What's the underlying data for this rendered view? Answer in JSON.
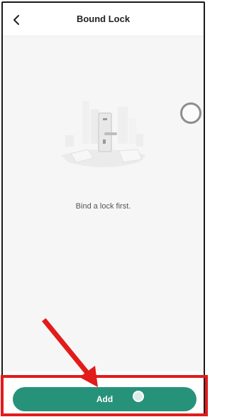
{
  "header": {
    "title": "Bound Lock",
    "back_icon": "chevron-left-icon"
  },
  "empty_state": {
    "message": "Bind a lock first.",
    "illustration": "door-lock-illustration"
  },
  "floating": {
    "icon": "circle-assistive-icon"
  },
  "footer": {
    "add_label": "Add",
    "add_dot": "touch-indicator-icon"
  },
  "annotation": {
    "color": "#e21b1b",
    "type": "arrow-pointing-to-add-button"
  },
  "colors": {
    "primary": "#27927a",
    "background": "#f6f6f6"
  }
}
